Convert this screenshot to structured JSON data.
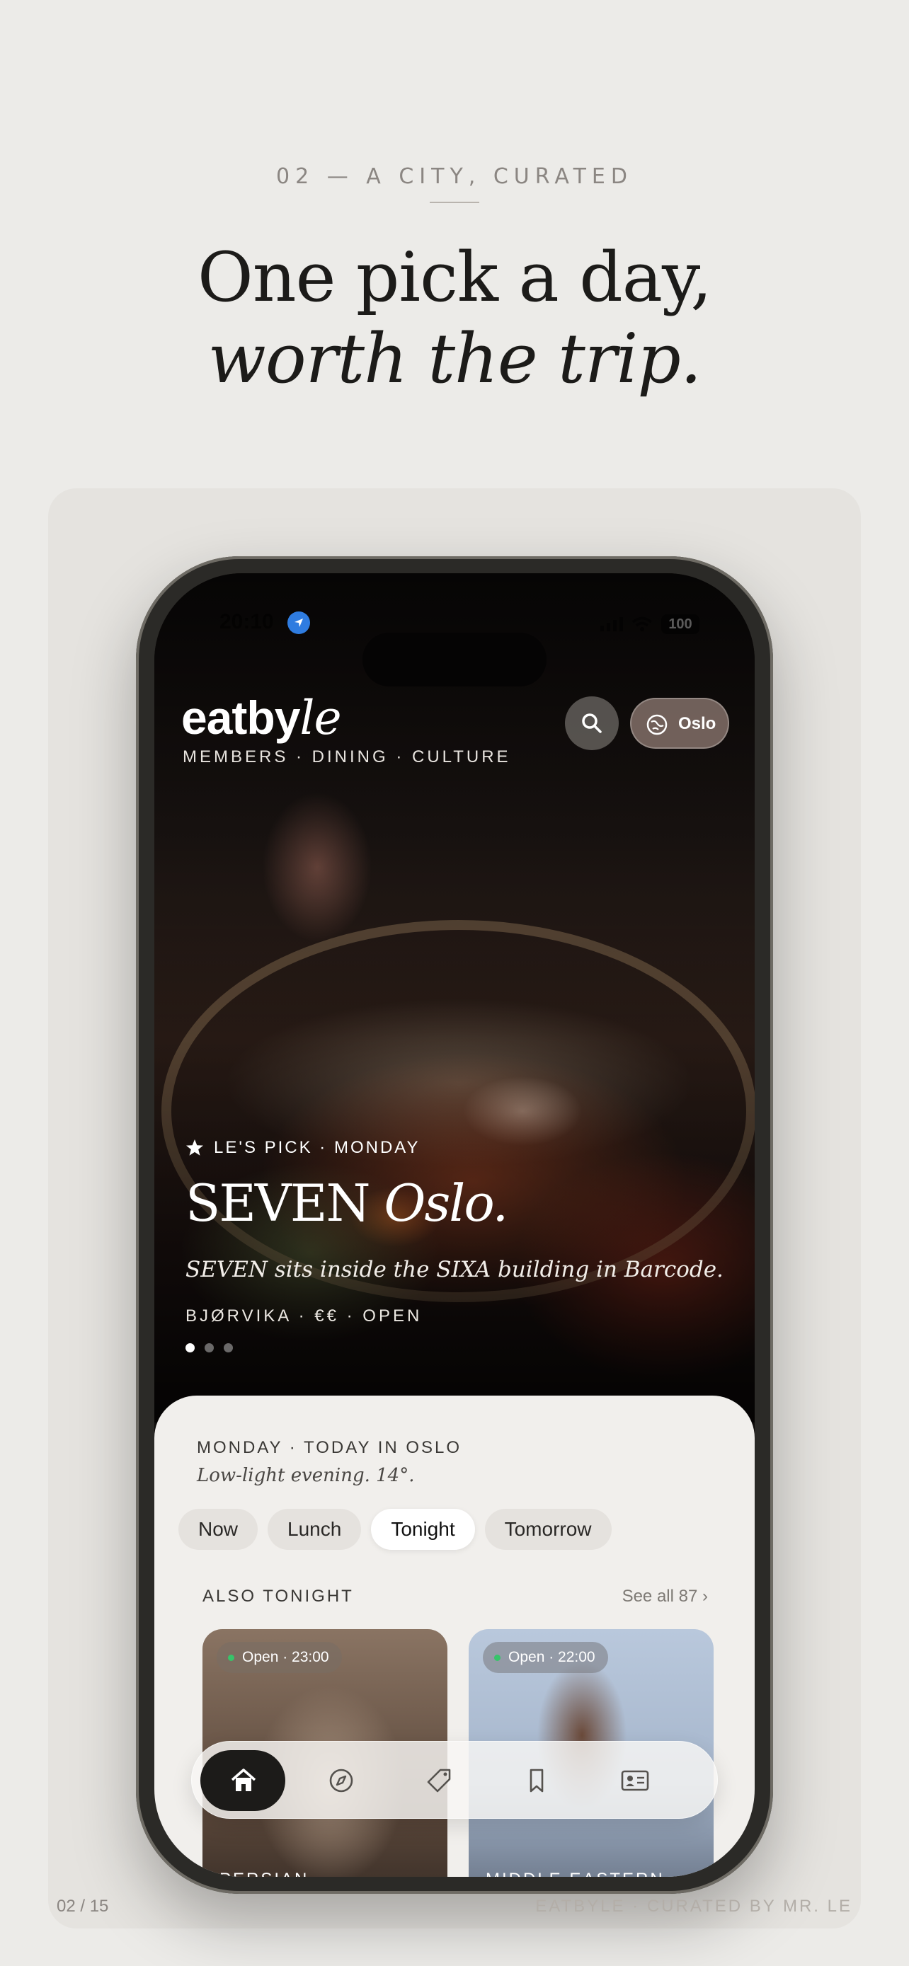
{
  "slide": {
    "kicker": "02 — A CITY, CURATED",
    "headline_line1": "One pick a day,",
    "headline_line2": "worth the trip.",
    "page_number": "02 / 15",
    "footer": "EATBYLE · CURATED BY MR. LE"
  },
  "status_bar": {
    "time": "20:10",
    "battery": "100"
  },
  "app": {
    "brand_main": "eatby",
    "brand_italic": "le",
    "tagline": "MEMBERS · DINING · CULTURE",
    "city_button_label": "Oslo",
    "icons": [
      "search-icon",
      "city-globe-icon",
      "location-arrow-icon"
    ]
  },
  "hero": {
    "pick_label": "LE'S PICK · MONDAY",
    "title_regular": "SEVEN",
    "title_italic": "Oslo.",
    "description": "SEVEN sits inside the SIXA building in Barcode.",
    "meta": "BJØRVIKA · €€ · OPEN",
    "carousel_pages": 3,
    "carousel_active": 1
  },
  "today": {
    "day_label": "MONDAY · TODAY IN OSLO",
    "weather_note": "Low-light evening. 14°.",
    "chips": [
      {
        "label": "Now",
        "active": false
      },
      {
        "label": "Lunch",
        "active": false
      },
      {
        "label": "Tonight",
        "active": true
      },
      {
        "label": "Tomorrow",
        "active": false
      }
    ],
    "section_title": "ALSO TONIGHT",
    "see_all": "See all 87"
  },
  "cards": [
    {
      "status": "Open · 23:00",
      "cuisine": "PERSIAN"
    },
    {
      "status": "Open · 22:00",
      "cuisine": "MIDDLE EASTERN"
    }
  ],
  "tabbar": {
    "items": [
      "home-icon",
      "explore-icon",
      "tag-icon",
      "bookmark-icon",
      "member-card-icon"
    ],
    "active_index": 0
  },
  "colors": {
    "background": "#ecebe8",
    "ink": "#1c1b19",
    "sheet": "#f1efec",
    "open_dot": "#37c46a"
  }
}
